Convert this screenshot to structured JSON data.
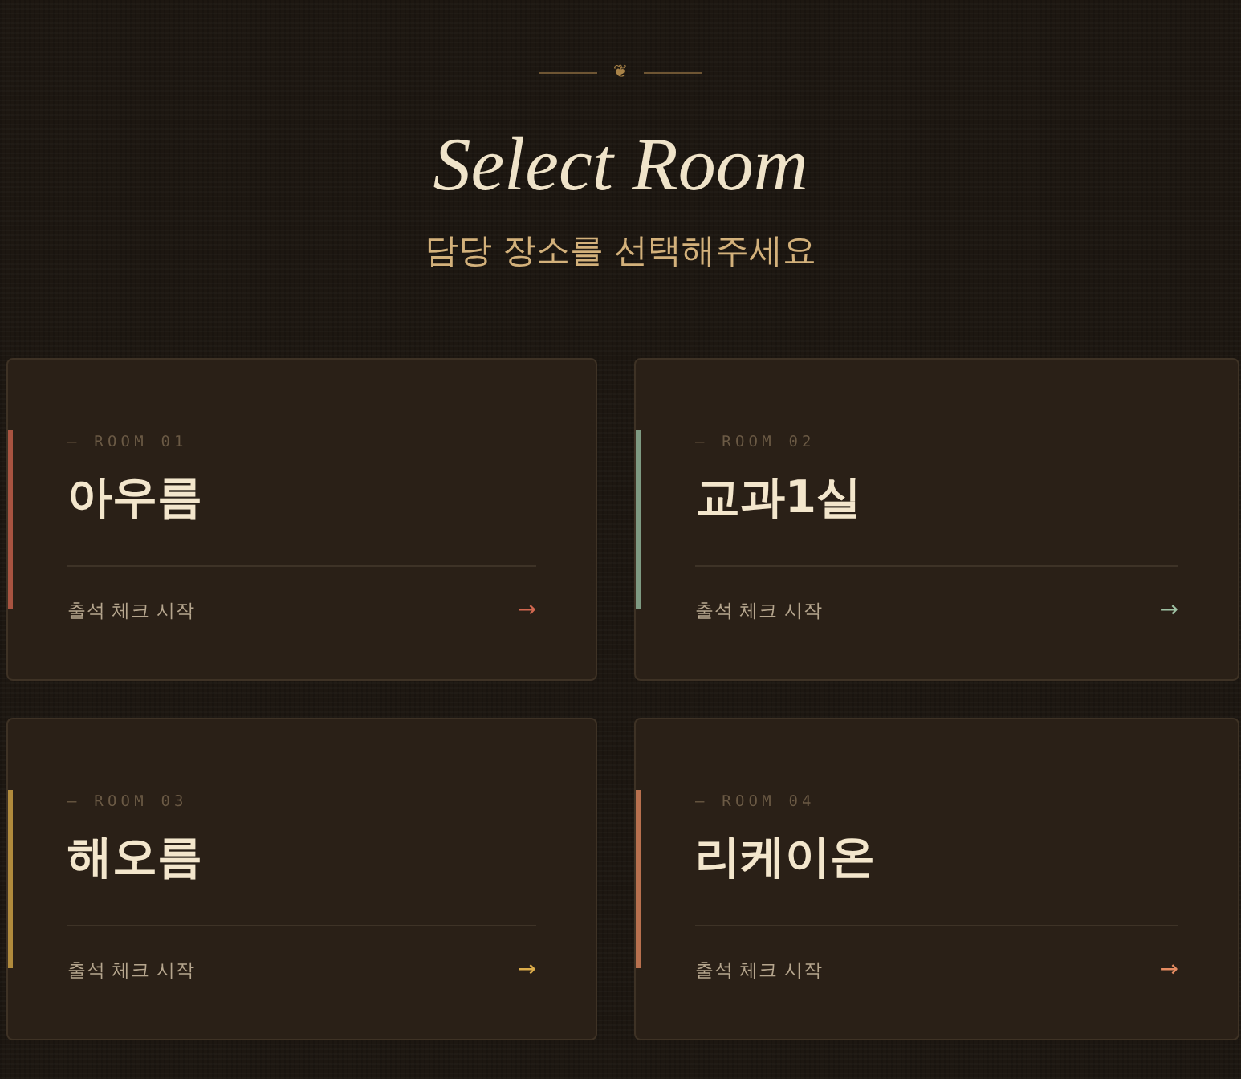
{
  "header": {
    "ornament": "❦",
    "title": "Select Room",
    "subtitle": "담당 장소를 선택해주세요"
  },
  "rooms": [
    {
      "label": "— ROOM 01",
      "name": "아우름",
      "action": "출석 체크 시작",
      "arrow": "→",
      "color": "#a85340"
    },
    {
      "label": "— ROOM 02",
      "name": "교과1실",
      "action": "출석 체크 시작",
      "arrow": "→",
      "color": "#7e9a82"
    },
    {
      "label": "— ROOM 03",
      "name": "해오름",
      "action": "출석 체크 시작",
      "arrow": "→",
      "color": "#b08a3c"
    },
    {
      "label": "— ROOM 04",
      "name": "리케이온",
      "action": "출석 체크 시작",
      "arrow": "→",
      "color": "#b8704e"
    }
  ]
}
